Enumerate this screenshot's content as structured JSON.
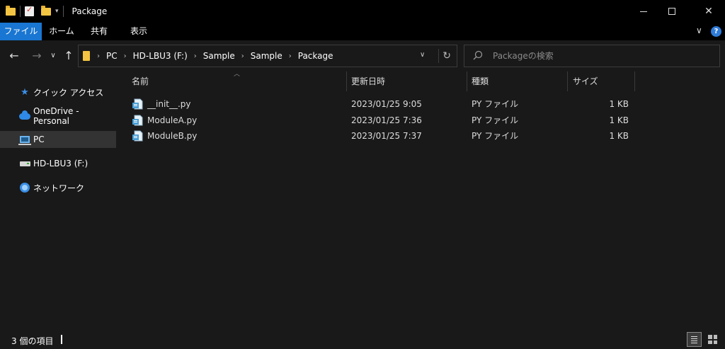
{
  "window": {
    "title": "Package",
    "minimize_glyph": "",
    "maximize_glyph": "",
    "close_glyph": "✕"
  },
  "ribbon": {
    "tabs": [
      {
        "label": "ファイル"
      },
      {
        "label": "ホーム"
      },
      {
        "label": "共有"
      },
      {
        "label": "表示"
      }
    ],
    "accent_color": "#1976d2"
  },
  "address": {
    "crumbs": [
      "PC",
      "HD-LBU3 (F:)",
      "Sample",
      "Sample",
      "Package"
    ]
  },
  "search": {
    "placeholder": "Packageの検索",
    "value": ""
  },
  "nav": {
    "items": [
      {
        "label": "クイック アクセス",
        "icon": "star-icon"
      },
      {
        "label": "OneDrive - Personal",
        "icon": "cloud-icon"
      },
      {
        "label": "PC",
        "icon": "computer-icon",
        "selected": true
      },
      {
        "label": "HD-LBU3 (F:)",
        "icon": "drive-icon"
      },
      {
        "label": "ネットワーク",
        "icon": "network-icon"
      }
    ]
  },
  "columns": {
    "name": "名前",
    "modified": "更新日時",
    "type": "種類",
    "size": "サイズ"
  },
  "files": [
    {
      "name": "__init__.py",
      "modified": "2023/01/25 9:05",
      "type": "PY ファイル",
      "size": "1 KB"
    },
    {
      "name": "ModuleA.py",
      "modified": "2023/01/25 7:36",
      "type": "PY ファイル",
      "size": "1 KB"
    },
    {
      "name": "ModuleB.py",
      "modified": "2023/01/25 7:37",
      "type": "PY ファイル",
      "size": "1 KB"
    }
  ],
  "status": {
    "item_count": "3 個の項目"
  }
}
